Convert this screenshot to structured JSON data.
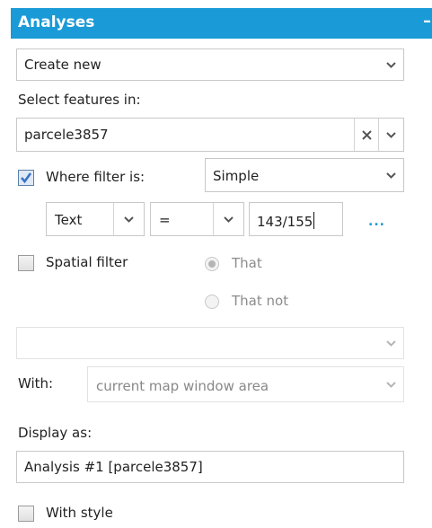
{
  "panel": {
    "title": "Analyses"
  },
  "analysis_select": {
    "value": "Create new"
  },
  "select_features_label": "Select features in:",
  "features_select": {
    "value": "parcele3857"
  },
  "where_filter": {
    "checked": true,
    "label": "Where filter is:",
    "mode_value": "Simple"
  },
  "condition": {
    "field_value": "Text",
    "operator_value": "=",
    "input_value": "143/155",
    "more_label": "..."
  },
  "spatial_filter": {
    "checked": false,
    "label": "Spatial filter",
    "option_that": "That",
    "option_that_not": "That not",
    "selected_option": "That"
  },
  "spatial_layer_select": {
    "value": ""
  },
  "with": {
    "label": "With:",
    "value": "current map window area"
  },
  "display_as": {
    "label": "Display as:",
    "value": "Analysis #1 [parcele3857]"
  },
  "with_style": {
    "checked": false,
    "label": "With style"
  },
  "colors": {
    "header": "#1a9ad6",
    "checkbox_check": "#3a73c4"
  },
  "icons": {
    "dropdown": "chevron-down-icon",
    "clear": "close-icon",
    "collapse": "minus-icon"
  }
}
